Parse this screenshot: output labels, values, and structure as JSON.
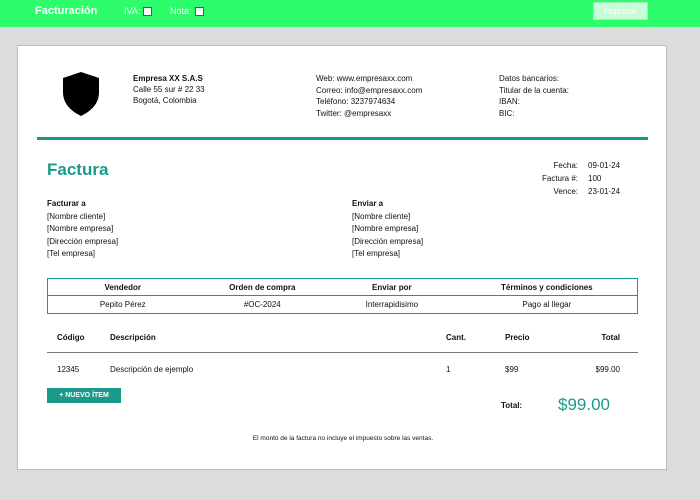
{
  "app": {
    "title": "Facturación",
    "print_label": "Imprimir"
  },
  "toggles": {
    "iva_label": "IVA:",
    "nota_label": "Nota:"
  },
  "company": {
    "name": "Empresa XX S.A.S",
    "address": "Calle 55 sur # 22 33",
    "city": "Bogotá, Colombia"
  },
  "contact": {
    "web": "Web: www.empresaxx.com",
    "email": "Correo: info@empresaxx.com",
    "phone": "Teléfono: 3237974634",
    "twitter": "Twitter: @empresaxx"
  },
  "bank": {
    "title": "Datos bancarios:",
    "holder": "Titular de la cuenta:",
    "iban": "IBAN:",
    "bic": "BIC:"
  },
  "invoice": {
    "title": "Factura",
    "meta": [
      {
        "label": "Fecha:",
        "value": "09-01-24"
      },
      {
        "label": "Factura #:",
        "value": "100"
      },
      {
        "label": "Vence:",
        "value": "23-01-24"
      }
    ]
  },
  "bill_to": {
    "heading": "Facturar a",
    "lines": [
      "[Nombre cliente]",
      "[Nombre empresa]",
      "[Dirección empresa]",
      "[Tel empresa]"
    ]
  },
  "ship_to": {
    "heading": "Enviar a",
    "lines": [
      "[Nombre cliente]",
      "[Nombre empresa]",
      "[Dirección empresa]",
      "[Tel empresa]"
    ]
  },
  "info_table": {
    "headers": [
      "Vendedor",
      "Orden de compra",
      "Enviar por",
      "Términos y condiciones"
    ],
    "values": [
      "Pepito Pérez",
      "#OC-2024",
      "Interrapidisimo",
      "Pago al llegar"
    ]
  },
  "items": {
    "headers": [
      "Código",
      "Descripción",
      "Cant.",
      "Precio",
      "Total"
    ],
    "rows": [
      {
        "code": "12345",
        "desc": "Descripción de ejemplo",
        "qty": "1",
        "price": "$99",
        "total": "$99.00"
      }
    ]
  },
  "new_item_label": "+ NUEVO ÍTEM",
  "total": {
    "label": "Total:",
    "value": "$99.00"
  },
  "footnote": "El monto de la factura no incluye el impuesto sobre las ventas.",
  "colors": {
    "topbar": "#2dfd6b",
    "accent": "#1b9a89"
  },
  "icons": {
    "logo": "shield-icon"
  }
}
